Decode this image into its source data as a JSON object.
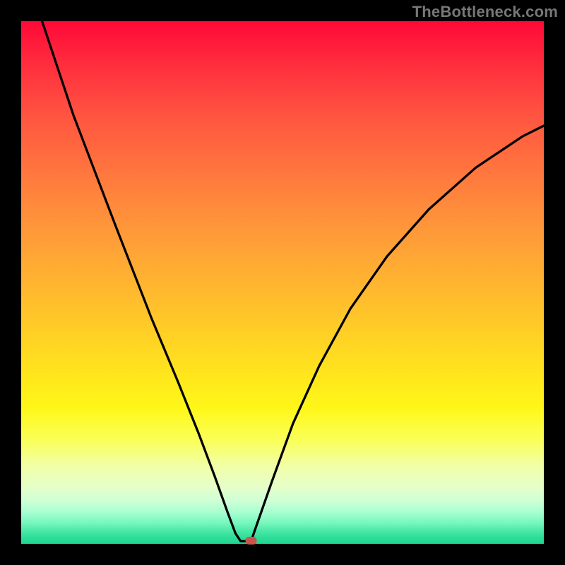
{
  "watermark": "TheBottleneck.com",
  "chart_data": {
    "type": "line",
    "title": "",
    "xlabel": "",
    "ylabel": "",
    "xlim": [
      0,
      100
    ],
    "ylim": [
      0,
      100
    ],
    "grid": false,
    "series": [
      {
        "name": "curve",
        "x": [
          4,
          10,
          18,
          25,
          30,
          34,
          37,
          39.5,
          41,
          42,
          42,
          44,
          44.5,
          48,
          52,
          57,
          63,
          70,
          78,
          87,
          96,
          100
        ],
        "values": [
          100,
          82,
          61,
          43,
          31,
          21,
          13,
          6,
          2,
          0.5,
          0.5,
          0.5,
          2,
          12,
          23,
          34,
          45,
          55,
          64,
          72,
          78,
          80
        ]
      }
    ],
    "marker": {
      "x": 44,
      "y": 0.6,
      "color": "#cc554b"
    },
    "background_gradient": {
      "stops": [
        {
          "pos": 0.0,
          "color": "#ff0937"
        },
        {
          "pos": 0.3,
          "color": "#ff7a3e"
        },
        {
          "pos": 0.55,
          "color": "#ffc22b"
        },
        {
          "pos": 0.74,
          "color": "#fff718"
        },
        {
          "pos": 0.92,
          "color": "#ccffd6"
        },
        {
          "pos": 1.0,
          "color": "#1fd691"
        }
      ]
    }
  }
}
